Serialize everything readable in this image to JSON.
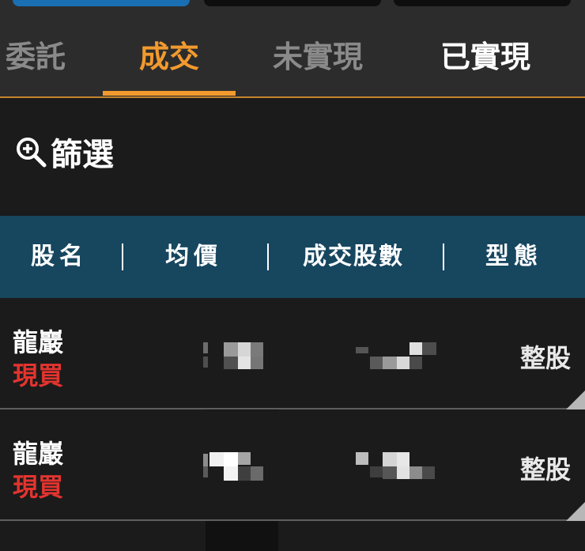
{
  "tabs": {
    "items": [
      {
        "label": "委託"
      },
      {
        "label": "成交"
      },
      {
        "label": "未實現"
      },
      {
        "label": "已實現"
      }
    ],
    "active_index": 1,
    "active_color": "#f29a2e"
  },
  "filter": {
    "icon": "zoom-in-icon",
    "label": "篩選"
  },
  "table": {
    "headers": [
      "股名",
      "均價",
      "成交股數",
      "型態"
    ],
    "header_bg": "#17465f",
    "rows": [
      {
        "name": "龍巖",
        "side": "現買",
        "avg_price": "",
        "quantity": "",
        "type": "整股"
      },
      {
        "name": "龍巖",
        "side": "現買",
        "avg_price": "",
        "quantity": "",
        "type": "整股"
      }
    ],
    "side_color": "#e3342f"
  }
}
